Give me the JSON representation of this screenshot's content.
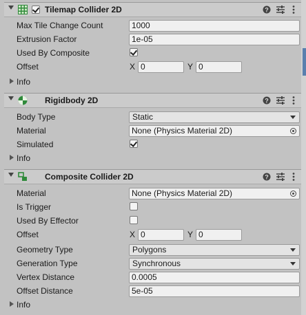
{
  "components": [
    {
      "title": "Tilemap Collider 2D",
      "enabled": true,
      "rows": [
        {
          "label": "Max Tile Change Count",
          "value": "1000"
        },
        {
          "label": "Extrusion Factor",
          "value": "1e-05"
        },
        {
          "label": "Used By Composite",
          "checked": true
        },
        {
          "label": "Offset",
          "x_label": "X",
          "x": "0",
          "y_label": "Y",
          "y": "0"
        }
      ],
      "info": "Info"
    },
    {
      "title": "Rigidbody 2D",
      "rows": [
        {
          "label": "Body Type",
          "value": "Static"
        },
        {
          "label": "Material",
          "value": "None (Physics Material 2D)"
        },
        {
          "label": "Simulated",
          "checked": true
        }
      ],
      "info": "Info"
    },
    {
      "title": "Composite Collider 2D",
      "rows": [
        {
          "label": "Material",
          "value": "None (Physics Material 2D)"
        },
        {
          "label": "Is Trigger",
          "checked": false
        },
        {
          "label": "Used By Effector",
          "checked": false
        },
        {
          "label": "Offset",
          "x_label": "X",
          "x": "0",
          "y_label": "Y",
          "y": "0"
        },
        {
          "label": "Geometry Type",
          "value": "Polygons"
        },
        {
          "label": "Generation Type",
          "value": "Synchronous"
        },
        {
          "label": "Vertex Distance",
          "value": "0.0005"
        },
        {
          "label": "Offset Distance",
          "value": "5e-05"
        }
      ],
      "info": "Info"
    }
  ],
  "icons": {
    "tilemap": "grid-icon",
    "rigidbody": "rigidbody-icon",
    "composite": "composite-collider-icon",
    "help": "help-icon",
    "presets": "presets-icon",
    "menu": "kebab-menu-icon",
    "object_picker": "object-picker-icon"
  },
  "colors": {
    "panel_bg": "#c2c2c2",
    "header_bg": "#cbcbcb",
    "field_bg": "#f0f0f0",
    "accent": "#5a7fae"
  }
}
